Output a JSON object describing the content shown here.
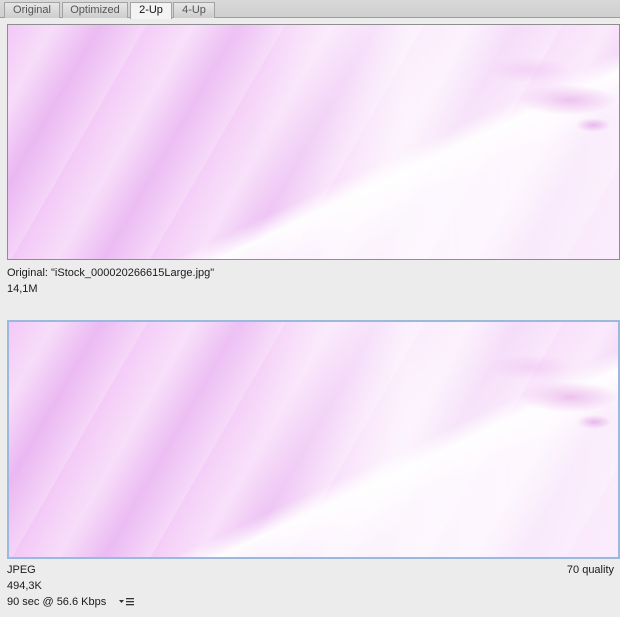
{
  "tabs": [
    {
      "label": "Original",
      "active": false
    },
    {
      "label": "Optimized",
      "active": false
    },
    {
      "label": "2-Up",
      "active": true
    },
    {
      "label": "4-Up",
      "active": false
    }
  ],
  "original": {
    "title": "Original: \"iStock_000020266615Large.jpg\"",
    "size": "14,1M"
  },
  "optimized": {
    "format": "JPEG",
    "size": "494,3K",
    "download_time": "90 sec @ 56.6 Kbps",
    "quality": "70 quality",
    "menu_icon": "download-rate-menu-icon"
  },
  "colors": {
    "selection_border": "#9bb9dd",
    "background": "#ececec"
  }
}
